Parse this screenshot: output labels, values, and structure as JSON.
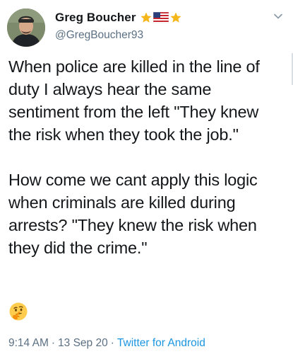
{
  "user": {
    "display_name": "Greg Boucher",
    "handle": "@GregBoucher93",
    "name_emoji": [
      "star-icon",
      "us-flag-icon",
      "star-icon"
    ]
  },
  "tweet": {
    "paragraph_1": "When police are killed in the line of duty I always hear the same sentiment from the left \"They knew the risk when they took the job.\"",
    "paragraph_2": "How come we cant apply this logic when criminals are killed during arrests? \"They knew the risk when they did the crime.\"",
    "emoji": "thinking-face-icon"
  },
  "meta": {
    "time": "9:14 AM",
    "separator": "·",
    "date": "13 Sep 20",
    "source": "Twitter for Android"
  },
  "colors": {
    "text": "#14171a",
    "secondary": "#5b7083",
    "link": "#1b95e0",
    "star": "#f5b619"
  }
}
